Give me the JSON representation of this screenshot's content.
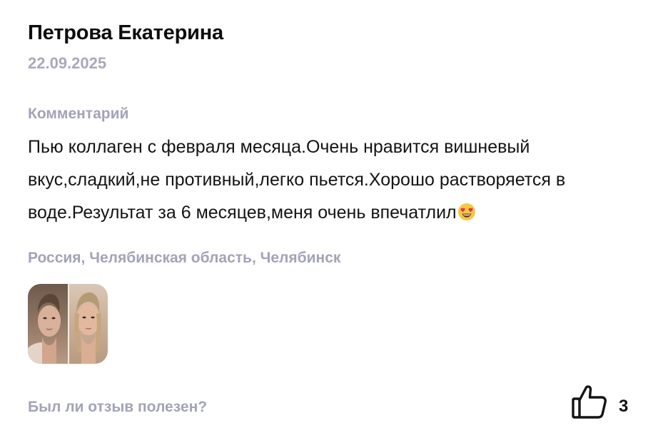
{
  "review": {
    "author": "Петрова Екатерина",
    "date": "22.09.2025",
    "comment_label": "Комментарий",
    "comment_text": "Пью коллаген с февраля месяца.Очень нравится вишневый вкус,сладкий,не противный,легко пьется.Хорошо растворяется в воде.Результат за 6 месяцев,меня очень впечатлил",
    "comment_emoji": "smiling-face-with-heart-eyes-icon",
    "location": "Россия, Челябинская область, Челябинск",
    "photo": "before-after-face-photo"
  },
  "feedback": {
    "question": "Был ли отзыв полезен?",
    "like_icon": "thumbs-up-icon",
    "like_count": "3"
  },
  "colors": {
    "text": "#141414",
    "muted": "#a3a3b8",
    "emoji_face": "#f7c842",
    "emoji_hearts": "#e8334a"
  }
}
